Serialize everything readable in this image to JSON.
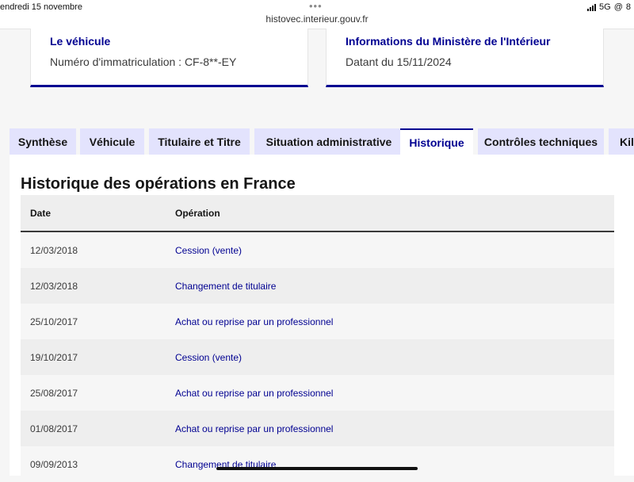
{
  "status_bar": {
    "date": "endredi 15 novembre",
    "url": "histovec.interieur.gouv.fr",
    "network": "5G",
    "battery": "8"
  },
  "cards": {
    "vehicle": {
      "title": "Le véhicule",
      "text": "Numéro d'immatriculation : CF-8**-EY"
    },
    "ministry": {
      "title": "Informations du Ministère de l'Intérieur",
      "text": "Datant du 15/11/2024"
    }
  },
  "tabs": [
    {
      "label": "Synthèse"
    },
    {
      "label": "Véhicule"
    },
    {
      "label": "Titulaire et Titre"
    },
    {
      "label": "Situation administrative"
    },
    {
      "label": "Historique"
    },
    {
      "label": "Contrôles techniques"
    },
    {
      "label": "Kilo"
    }
  ],
  "active_tab": "Historique",
  "history": {
    "title": "Historique des opérations en France",
    "columns": {
      "date": "Date",
      "operation": "Opération"
    },
    "rows": [
      {
        "date": "12/03/2018",
        "operation": "Cession (vente)"
      },
      {
        "date": "12/03/2018",
        "operation": "Changement de titulaire"
      },
      {
        "date": "25/10/2017",
        "operation": "Achat ou reprise par un professionnel"
      },
      {
        "date": "19/10/2017",
        "operation": "Cession (vente)"
      },
      {
        "date": "25/08/2017",
        "operation": "Achat ou reprise par un professionnel"
      },
      {
        "date": "01/08/2017",
        "operation": "Achat ou reprise par un professionnel"
      },
      {
        "date": "09/09/2013",
        "operation": "Changement de titulaire"
      }
    ]
  },
  "colors": {
    "accent": "#000091",
    "tab_background": "#e3e3fd",
    "page_background": "#f6f6f6"
  }
}
